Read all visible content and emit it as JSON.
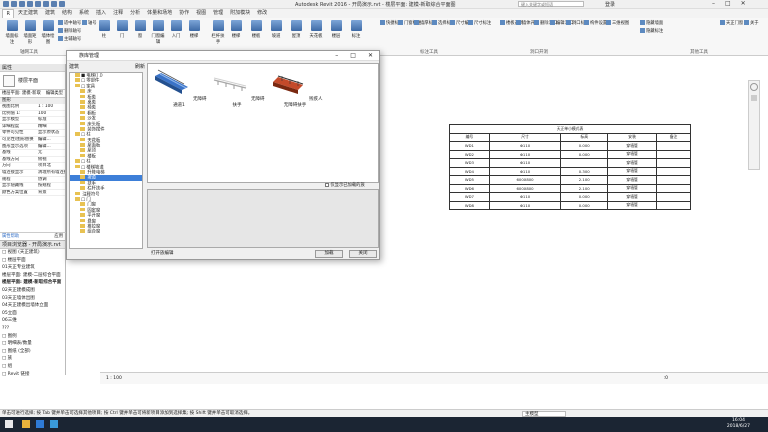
{
  "titlebar": {
    "title": "Autodesk Revit 2016 -    开局演示.rvt - 楼层平面: 建模-新取综合平面图",
    "search_placeholder": "键入关键字或短语",
    "login": "登录"
  },
  "menu_tabs": [
    "R",
    "天正建筑",
    "建筑",
    "结构",
    "系统",
    "插入",
    "注释",
    "分析",
    "体量和场地",
    "协作",
    "视图",
    "管理",
    "附加模块",
    "修改"
  ],
  "menu_active": 0,
  "ribbon": {
    "buttons": [
      "墙面标注",
      "墙面矩形",
      "墙体绘图",
      "柱",
      "门",
      "窗",
      "门窗编辑",
      "入门",
      "楼梯",
      "栏杆扶手",
      "楼梯",
      "楼板",
      "坡道",
      "屋顶",
      "天花板",
      "楼层",
      "标注"
    ],
    "small": [
      "适中轴号",
      "删除轴号",
      "主辅轴号",
      "轴号",
      "快捷标注",
      "门窗标注",
      "墙厚标注",
      "选择标注",
      "尺寸编辑",
      "尺寸标注",
      "楼板开洞",
      "墙体开洞",
      "删除洞口",
      "编辑洞口",
      "洞口标注",
      "构件设置",
      "三维视图",
      "隐藏墙面",
      "隐藏标注",
      "天正门窗",
      "关于"
    ],
    "groups": [
      "轴网工具",
      "标注工具",
      "洞口开洞",
      "其他工具"
    ]
  },
  "properties": {
    "header": "属性",
    "type_label": "楼层平面",
    "selector": "楼层平面: 建模-新取",
    "edit_type": "编辑类型",
    "section": "图形",
    "rows": [
      {
        "k": "视图比例",
        "v": "1 : 100"
      },
      {
        "k": "比例值 1:",
        "v": "100"
      },
      {
        "k": "显示模型",
        "v": "标准"
      },
      {
        "k": "详细程度",
        "v": "精细"
      },
      {
        "k": "零件可见性",
        "v": "显示原状态"
      },
      {
        "k": "可见性/图形替换",
        "v": "编辑..."
      },
      {
        "k": "图形显示选项",
        "v": "编辑..."
      },
      {
        "k": "基线",
        "v": "无"
      },
      {
        "k": "基线方向",
        "v": "俯视"
      },
      {
        "k": "方向",
        "v": "项目北"
      },
      {
        "k": "墙连接显示",
        "v": "清理所有墙连接"
      },
      {
        "k": "规程",
        "v": "协调"
      },
      {
        "k": "显示隐藏线",
        "v": "按规程"
      },
      {
        "k": "颜色方案位置",
        "v": "背景"
      }
    ],
    "help_link": "属性帮助",
    "apply": "应用"
  },
  "browser": {
    "header": "项目浏览器 - 开局演示.rvt",
    "items": [
      "□ 视图 (天正建筑)",
      "  □ 楼层平面",
      "    01天正专业建筑",
      "      楼层平面: 建模-二层综合平面",
      "      楼层平面: 建模-新取综合平面",
      "    02天正建模成图",
      "    03天正墙体出图",
      "    04天正建模出墙体立面",
      "    05立面",
      "    06三维",
      "    ???",
      "□ 图例",
      "□ 明细表/数量",
      "□ 图纸 (全部)",
      "□ 族",
      "□ 组",
      "□ Revit 链接"
    ]
  },
  "dialog": {
    "title": "族库管理",
    "tree_label": "建筑",
    "tree_label2": "刷新",
    "tree": [
      {
        "t": "■ 电梯(门)",
        "i": 1
      },
      {
        "t": "□ 零部件",
        "i": 1
      },
      {
        "t": "□ 家具",
        "i": 1
      },
      {
        "t": "  床",
        "i": 2
      },
      {
        "t": "  柜类",
        "i": 2
      },
      {
        "t": "  桌类",
        "i": 2
      },
      {
        "t": "  椅类",
        "i": 2
      },
      {
        "t": "  橱柜",
        "i": 2
      },
      {
        "t": "  沙发",
        "i": 2
      },
      {
        "t": "  床头柜",
        "i": 2
      },
      {
        "t": "  装饰摆件",
        "i": 2
      },
      {
        "t": "□ 柱",
        "i": 1
      },
      {
        "t": "  天花板",
        "i": 2
      },
      {
        "t": "  屋面板",
        "i": 2
      },
      {
        "t": "  屋顶",
        "i": 2
      },
      {
        "t": "  楼板",
        "i": 2
      },
      {
        "t": "□ 柱",
        "i": 1
      },
      {
        "t": "□ 楼梯坡道",
        "i": 1
      },
      {
        "t": "  升降电梯",
        "i": 2
      },
      {
        "t": "  坡道",
        "i": 2
      },
      {
        "t": "  扶手",
        "i": 2
      },
      {
        "t": "  栏杆扶手",
        "i": 2
      },
      {
        "t": "  注释符号",
        "i": 1
      },
      {
        "t": "□ 门",
        "i": 1
      },
      {
        "t": "  门窗",
        "i": 2
      },
      {
        "t": "  固定窗",
        "i": 2
      },
      {
        "t": "  平开窗",
        "i": 2
      },
      {
        "t": "  悬窗",
        "i": 2
      },
      {
        "t": "  推拉窗",
        "i": 2
      },
      {
        "t": "  组合窗",
        "i": 2
      }
    ],
    "tree_selected": 19,
    "thumbs": [
      "无障碍通道1",
      "无障碍扶手",
      "残疾人无障碍扶手"
    ],
    "only_loaded": "仅显示已加载的族",
    "open_editor": "打开族编辑",
    "load": "加载",
    "close": "关闭"
  },
  "schedule": {
    "title": "天正单小模式表",
    "headers": [
      "编号",
      "尺寸",
      "标高",
      "安装",
      "备注"
    ],
    "rows": [
      [
        "WD1",
        "Φ110",
        "0.000",
        "穿墙管",
        ""
      ],
      [
        "WD2",
        "Φ110",
        "0.000",
        "穿墙管",
        ""
      ],
      [
        "WD3",
        "Φ110",
        "",
        "穿墙管",
        ""
      ],
      [
        "WD4",
        "Φ110",
        "0.300",
        "穿墙管",
        ""
      ],
      [
        "WD5",
        "600X800",
        "2.100",
        "穿墙管",
        ""
      ],
      [
        "WD6",
        "600X800",
        "2.100",
        "穿墙管",
        ""
      ],
      [
        "WD7",
        "Φ110",
        "0.000",
        "穿墙管",
        ""
      ],
      [
        "WD8",
        "Φ110",
        "0.000",
        "穿墙管",
        ""
      ]
    ]
  },
  "view_control": {
    "scale": "1 : 100",
    "zero": ":0"
  },
  "status_text": "单击可进行选择; 按 Tab 键并单击可选择其他项目; 按 Ctrl 键并单击可将新项目添加到选择集; 按 Shift 键并单击可取消选择。",
  "status_model": "主模型",
  "taskbar": {
    "time": "16:04",
    "date": "2018/6/27"
  },
  "colors": {
    "accent": "#2d6bc4",
    "taskbar": "#1b2533"
  }
}
